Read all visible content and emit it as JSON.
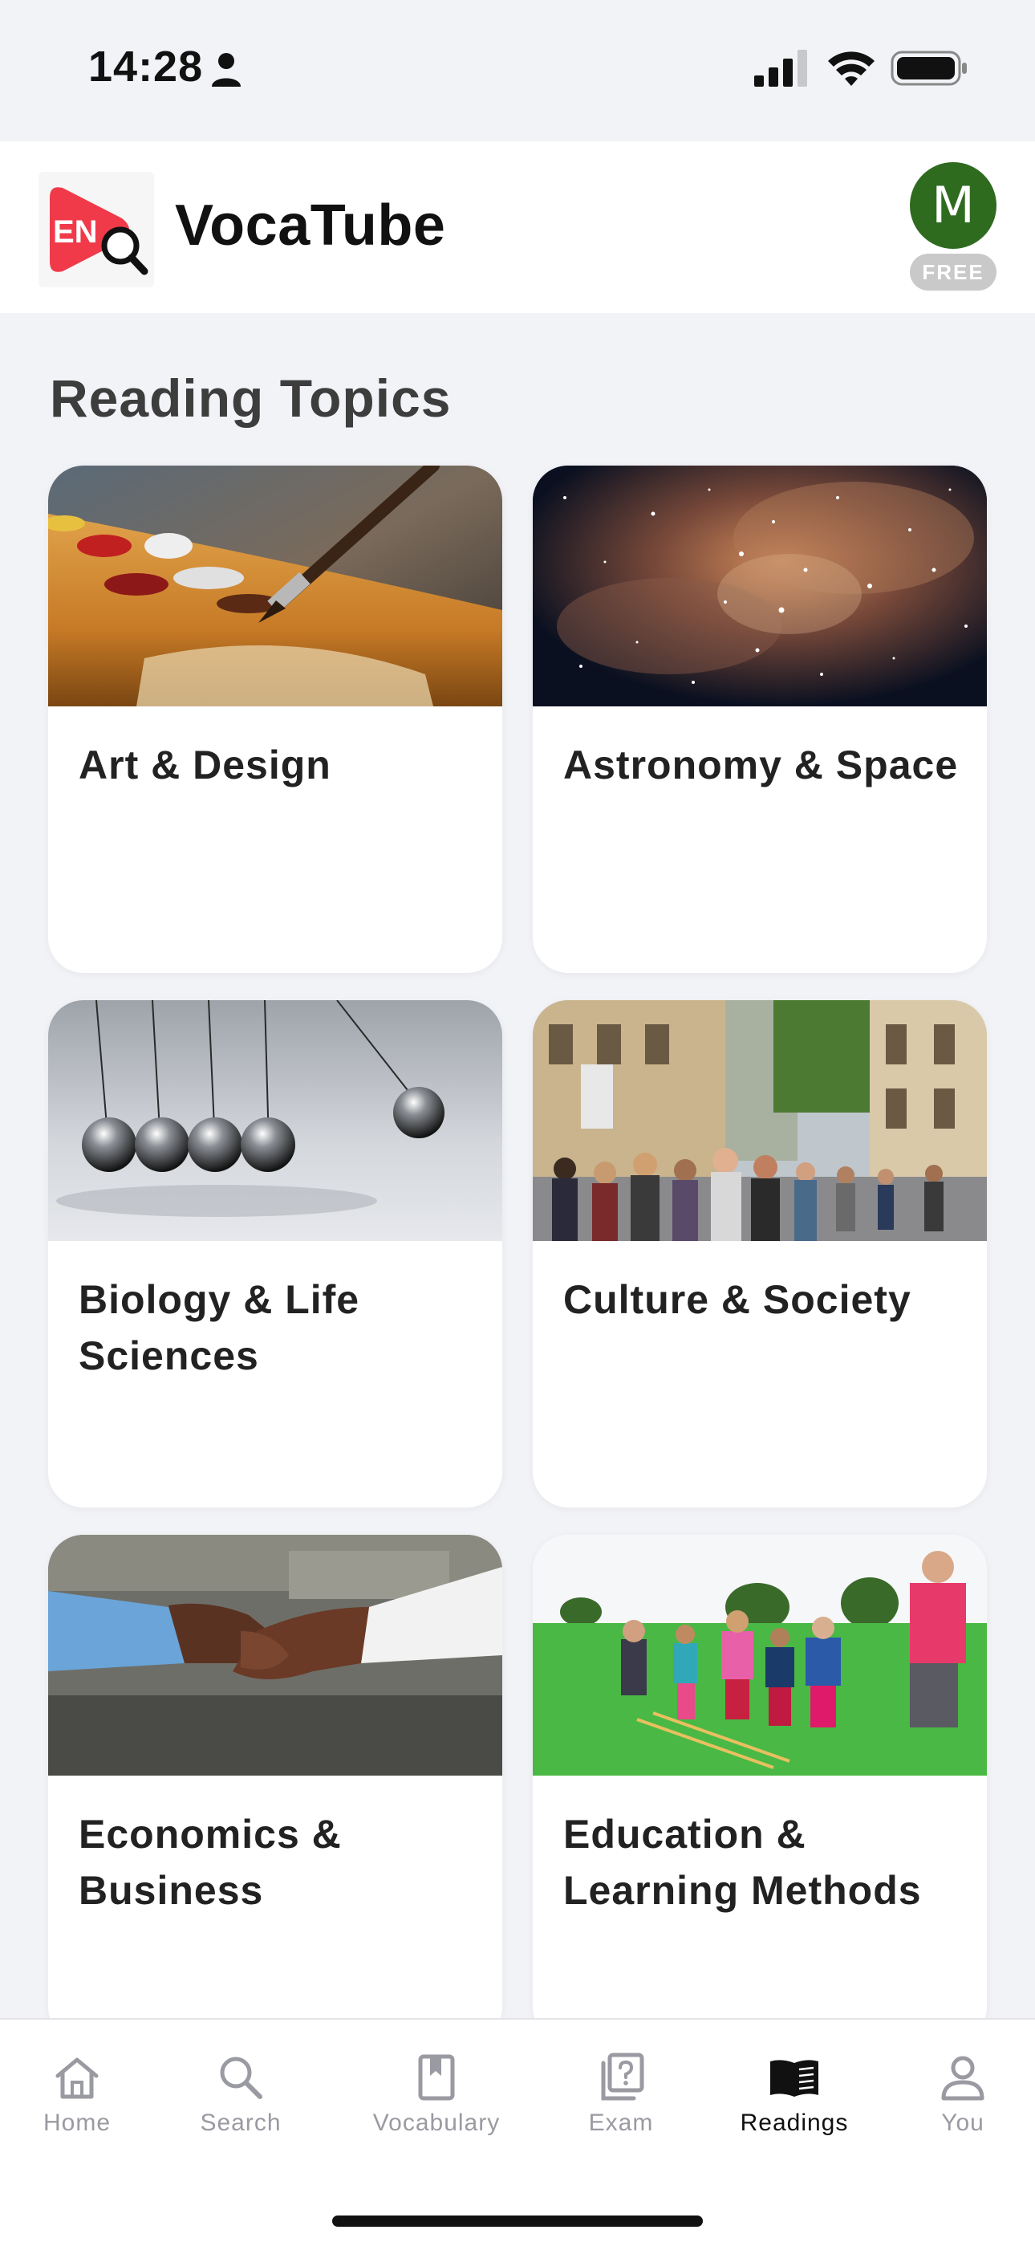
{
  "status_bar": {
    "time": "14:28",
    "icons": [
      "person-icon",
      "cellular-signal-icon",
      "wifi-icon",
      "battery-icon"
    ]
  },
  "header": {
    "logo_text": "EN",
    "app_name": "VocaTube",
    "avatar_initial": "M",
    "plan_badge": "FREE",
    "colors": {
      "logo_red": "#f03a4a",
      "avatar_green": "#2f6b1f",
      "badge_gray": "#c9c9c9"
    }
  },
  "main": {
    "section_title": "Reading Topics",
    "topics": [
      {
        "label": "Art & Design",
        "image": "paintbrush-palette-image"
      },
      {
        "label": "Astronomy & Space",
        "image": "nebula-starfield-image"
      },
      {
        "label": "Biology & Life Sciences",
        "image": "newtons-cradle-image"
      },
      {
        "label": "Culture & Society",
        "image": "crowded-street-image"
      },
      {
        "label": "Economics & Business",
        "image": "handshake-image"
      },
      {
        "label": "Education & Learning Methods",
        "image": "children-playing-field-image"
      }
    ]
  },
  "tab_bar": {
    "active": "Readings",
    "tabs": [
      {
        "label": "Home",
        "icon": "home-icon"
      },
      {
        "label": "Search",
        "icon": "search-icon"
      },
      {
        "label": "Vocabulary",
        "icon": "bookmark-book-icon"
      },
      {
        "label": "Exam",
        "icon": "question-cards-icon"
      },
      {
        "label": "Readings",
        "icon": "open-book-icon"
      },
      {
        "label": "You",
        "icon": "person-icon"
      }
    ]
  }
}
